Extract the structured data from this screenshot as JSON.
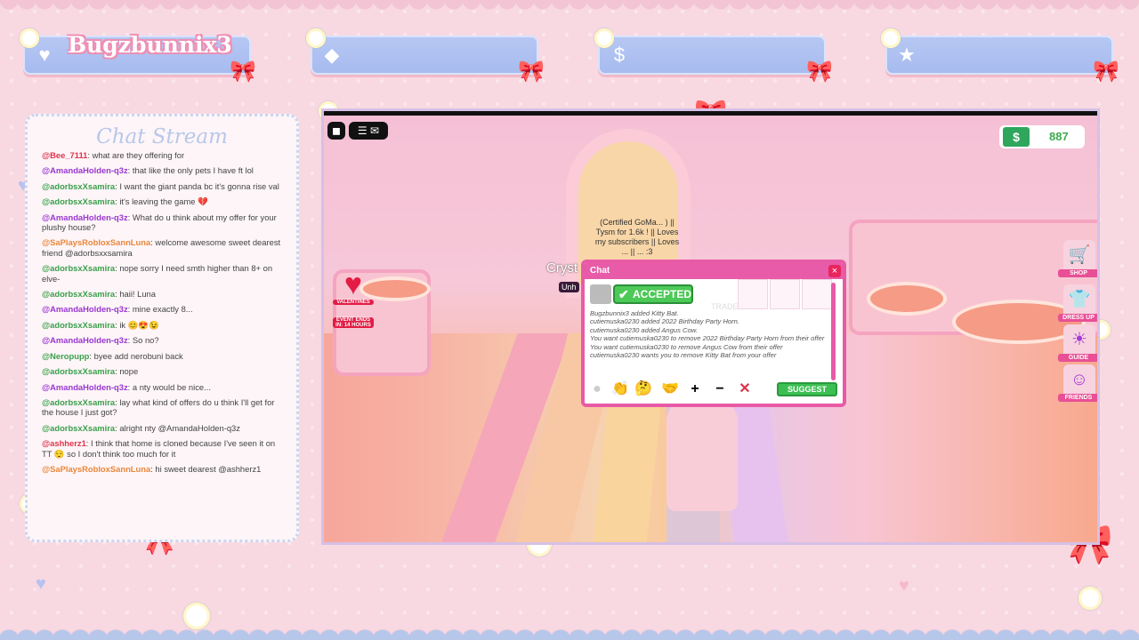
{
  "stream": {
    "channel_name": "Bugzbunnix3",
    "chat_title": "Chat Stream",
    "bars": [
      {
        "icon": "heart-icon"
      },
      {
        "icon": "diamond-icon"
      },
      {
        "icon": "money-bag-icon"
      },
      {
        "icon": "star-icon"
      }
    ]
  },
  "chat_messages": [
    {
      "user": "@Bee_7111",
      "text": "what are they offering for",
      "color": "#e0334a"
    },
    {
      "user": "@AmandaHolden-q3z",
      "text": "that like the only pets I have ft lol",
      "color": "#9a36d1"
    },
    {
      "user": "@adorbsxXsamira",
      "text": "I want the giant panda bc it's gonna rise val",
      "color": "#3aa04a"
    },
    {
      "user": "@adorbsxXsamira",
      "text": "it's leaving the game 💔",
      "color": "#3aa04a"
    },
    {
      "user": "@AmandaHolden-q3z",
      "text": "What do u think about my offer for your plushy house?",
      "color": "#9a36d1"
    },
    {
      "user": "@SaPlaysRobloxSannLuna",
      "text": "welcome awesome sweet dearest friend @adorbsxxsamira",
      "color": "#e8873a"
    },
    {
      "user": "@adorbsxXsamira",
      "text": "nope sorry I need smth higher than 8+ on elve-",
      "color": "#3aa04a"
    },
    {
      "user": "@adorbsxXsamira",
      "text": "haii! Luna",
      "color": "#3aa04a"
    },
    {
      "user": "@AmandaHolden-q3z",
      "text": "mine exactly 8...",
      "color": "#9a36d1"
    },
    {
      "user": "@adorbsxXsamira",
      "text": "ik 😊😍😉",
      "color": "#3aa04a"
    },
    {
      "user": "@AmandaHolden-q3z",
      "text": "So no?",
      "color": "#9a36d1"
    },
    {
      "user": "@Neropupp",
      "text": "byee add nerobuni back",
      "color": "#3aa04a"
    },
    {
      "user": "@adorbsxXsamira",
      "text": "nope",
      "color": "#3aa04a"
    },
    {
      "user": "@AmandaHolden-q3z",
      "text": "a nty would be nice...",
      "color": "#9a36d1"
    },
    {
      "user": "@adorbsxXsamira",
      "text": "lay what kind of offers do u think I'll get for the house I just got?",
      "color": "#3aa04a"
    },
    {
      "user": "@adorbsxXsamira",
      "text": "alright nty @AmandaHolden-q3z",
      "color": "#3aa04a"
    },
    {
      "user": "@ashherz1",
      "text": "I think that home is cloned because I've seen it on TT 😌 so I don't think too much for it",
      "color": "#e0334a"
    },
    {
      "user": "@SaPlaysRobloxSannLuna",
      "text": "hi sweet dearest @ashherz1",
      "color": "#e8873a"
    }
  ],
  "game": {
    "money": "887",
    "player_tag": "Cryst",
    "player_tag_sub": "Unh",
    "nameplate": "(Certified GoMa... ) || Tysm for 1.6k ! || Loves my subscribers || Loves ... || ... :3",
    "valentine_label": "VALENTINES",
    "event_label": "EVENT ENDS IN: 14 HOURS",
    "side_buttons": [
      {
        "label": "SHOP",
        "icon": "cart-icon"
      },
      {
        "label": "DRESS UP",
        "icon": "shirt-icon"
      },
      {
        "label": "GUIDE",
        "icon": "sun-icon"
      },
      {
        "label": "FRIENDS",
        "icon": "friends-icon"
      }
    ],
    "trade": {
      "header": "Chat",
      "accepted_label": "ACCEPTED",
      "trade_ghost": "TRADE",
      "log": [
        "Bugzbunnix3 added Kitty Bat.",
        "cutiemuska0230 added 2022 Birthday Party Horn.",
        "cutiemuska0230 added Angus Cow.",
        "You want cutiemuska0230 to remove 2022 Birthday Party Horn from their offer",
        "You want cutiemuska0230 to remove Angus Cow from their offer",
        "cutiemuska0230 wants you to remove Kitty Bat from your offer"
      ],
      "suggest_label": "SUGGEST",
      "close_symbol": "×"
    }
  }
}
